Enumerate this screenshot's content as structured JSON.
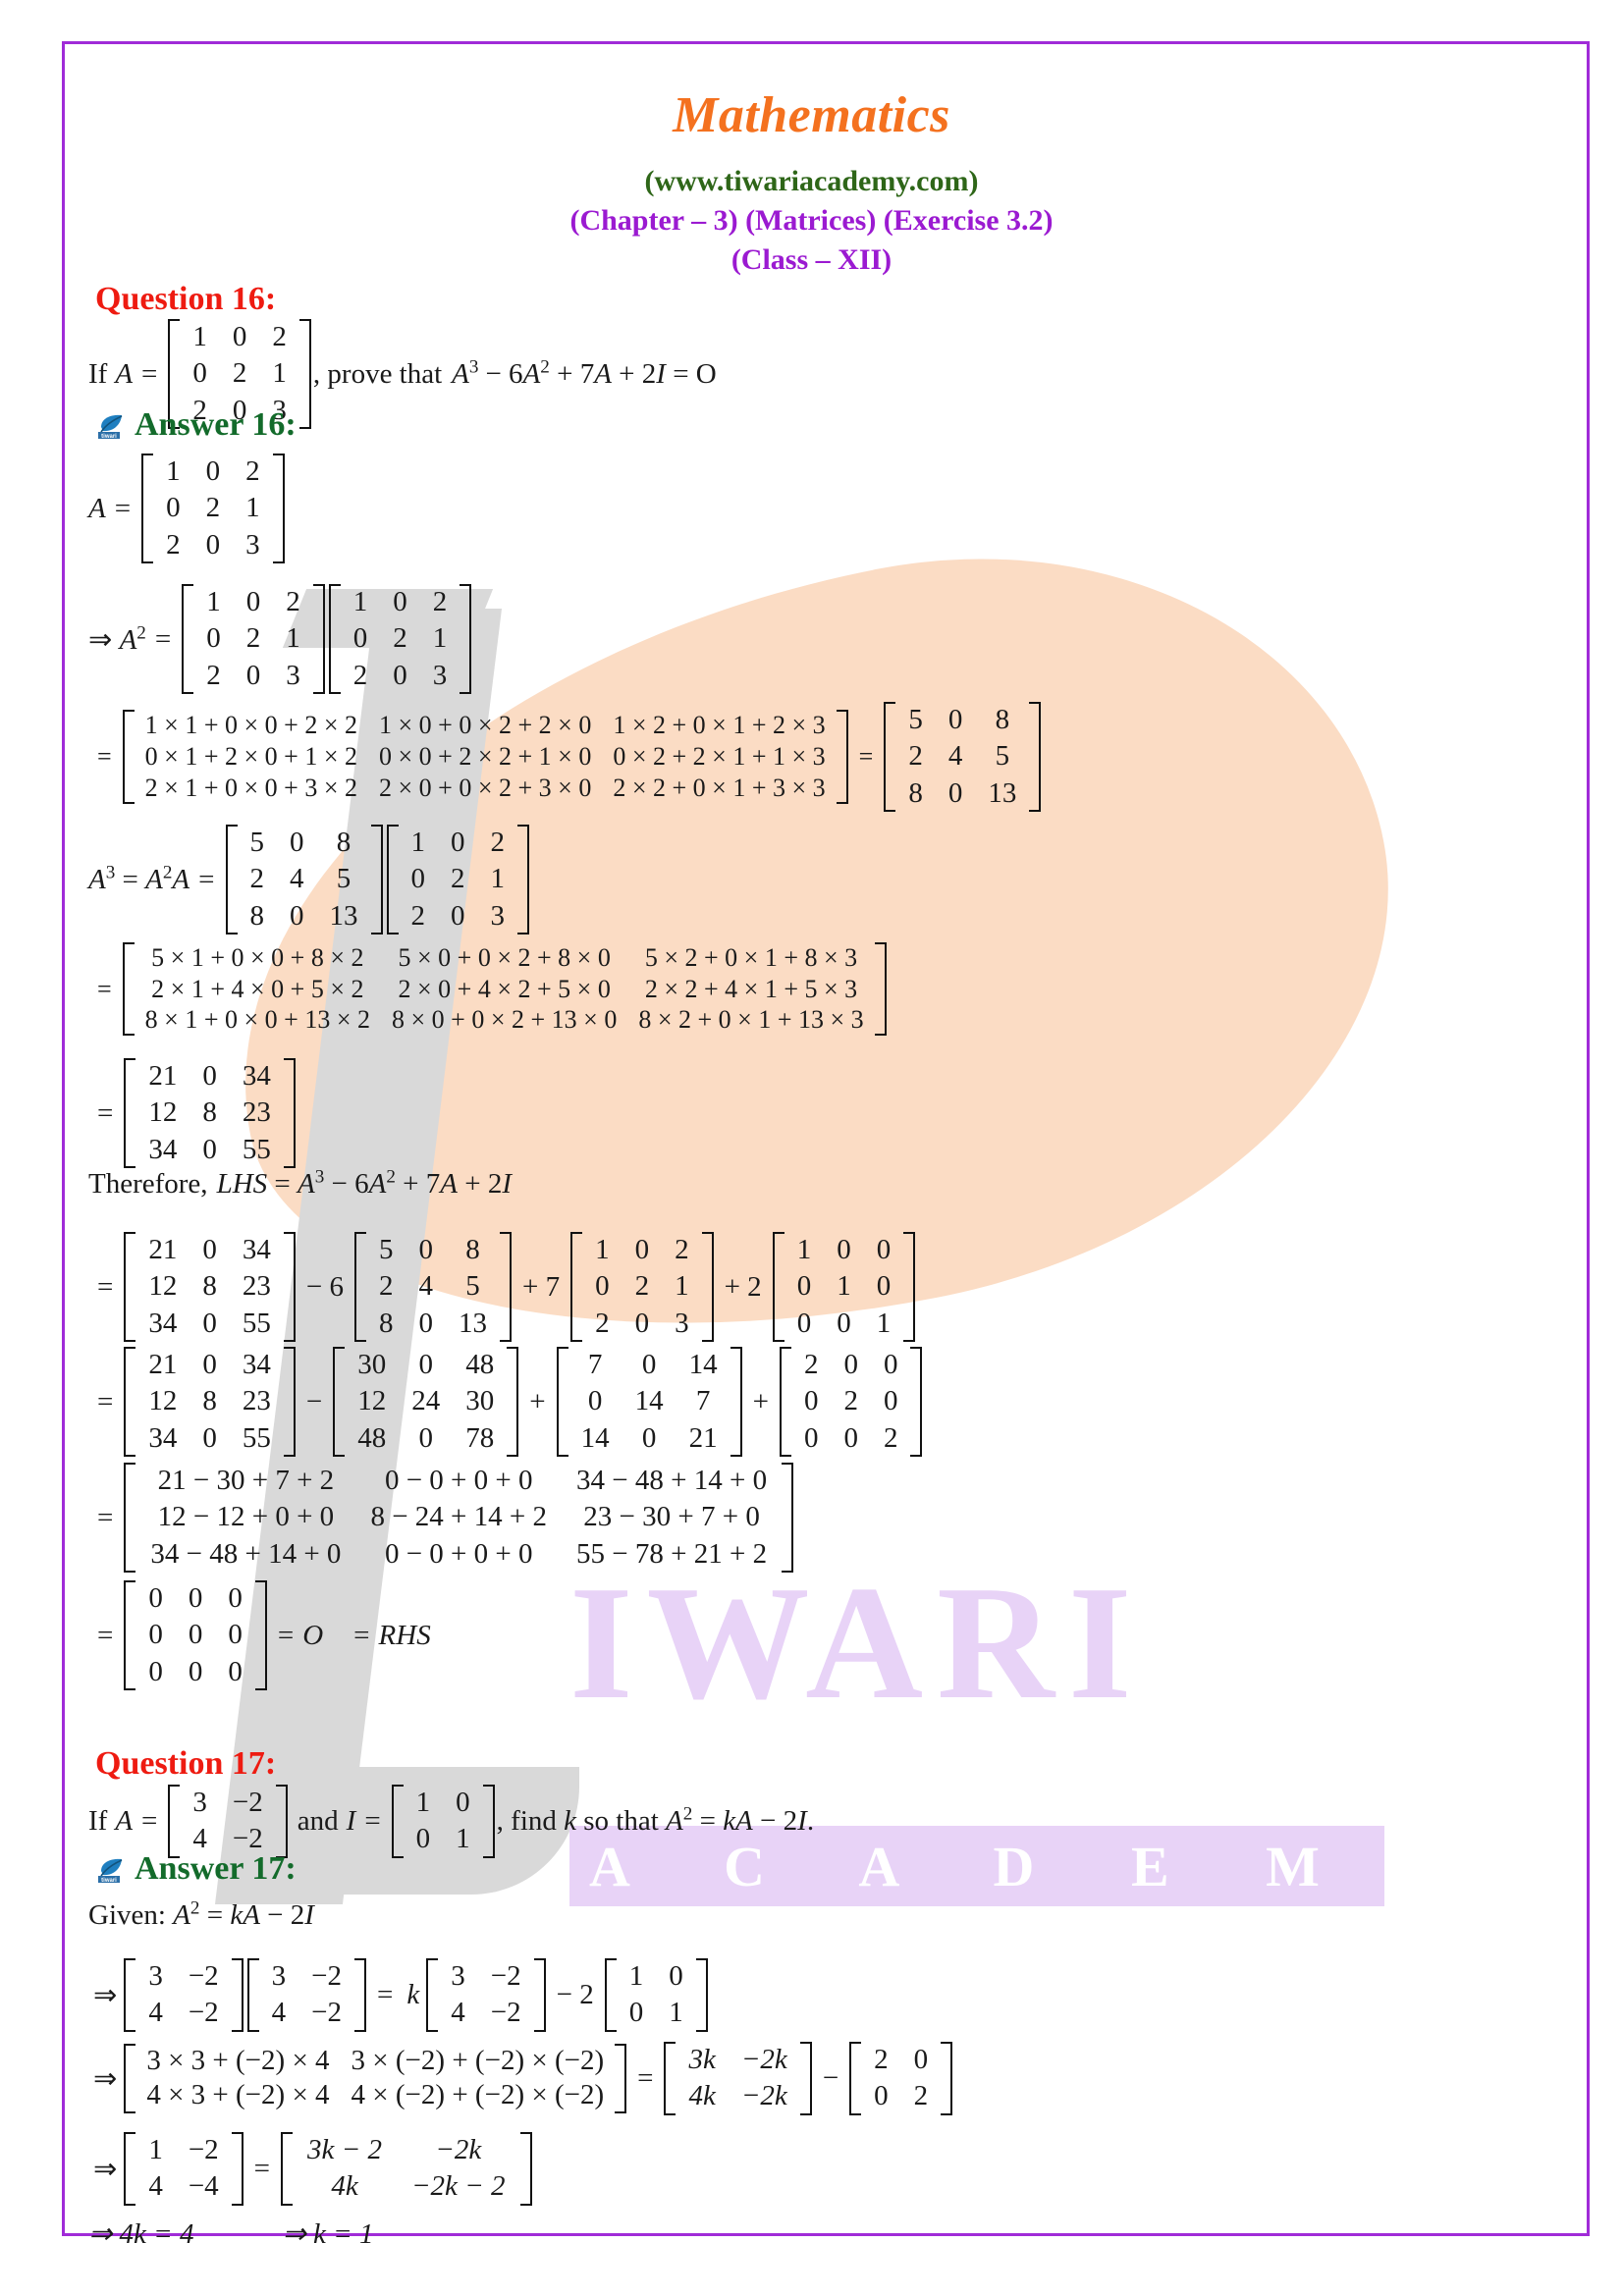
{
  "header": {
    "title": "Mathematics",
    "site": "(www.tiwariacademy.com)",
    "subtitle1": "(Chapter – 3) (Matrices) (Exercise 3.2)",
    "subtitle2": "(Class – XII)"
  },
  "watermark": {
    "big_text": "IWARI",
    "band_text": "A C A D E M Y"
  },
  "colors": {
    "border": "#a02bd8",
    "title": "#f4711f",
    "site": "#2e6618",
    "subtitle": "#9b1ad1",
    "question": "#ee1b11",
    "answer": "#136b2b",
    "watermark_peach": "#fbdcc4",
    "watermark_grey": "#d9d9d9",
    "watermark_purple": "#e8d3f7"
  },
  "q16": {
    "label": "Question 16:",
    "answer_label": "Answer 16:",
    "prompt_lead": "If",
    "prompt_var": "A",
    "prompt_eq": "=",
    "prompt_tail": ", prove that",
    "prompt_expr_a3": "A",
    "prompt_expr": "− 6A + 7A + 2I = O",
    "matrix_A": [
      [
        "1",
        "0",
        "2"
      ],
      [
        "0",
        "2",
        "1"
      ],
      [
        "2",
        "0",
        "3"
      ]
    ],
    "a_eq_lead": "A",
    "a2_lead": "⇒ A",
    "a2_expansion": [
      [
        "1 × 1 + 0 × 0 + 2 × 2",
        "1 × 0 + 0 × 2 + 2 × 0",
        "1 × 2 + 0 × 1 + 2 × 3"
      ],
      [
        "0 × 1 + 2 × 0 + 1 × 2",
        "0 × 0 + 2 × 2 + 1 × 0",
        "0 × 2 + 2 × 1 + 1 × 3"
      ],
      [
        "2 × 1 + 0 × 0 + 3 × 2",
        "2 × 0 + 0 × 2 + 3 × 0",
        "2 × 2 + 0 × 1 + 3 × 3"
      ]
    ],
    "matrix_A2": [
      [
        "5",
        "0",
        "8"
      ],
      [
        "2",
        "4",
        "5"
      ],
      [
        "8",
        "0",
        "13"
      ]
    ],
    "a3_label_1": "A",
    "a3_label_2": "= A",
    "a3_label_3": "A",
    "a3_expansion": [
      [
        "5 × 1 + 0 × 0 + 8 × 2",
        "5 × 0 + 0 × 2 + 8 × 0",
        "5 × 2 + 0 × 1 + 8 × 3"
      ],
      [
        "2 × 1 + 4 × 0 + 5 × 2",
        "2 × 0 + 4 × 2 + 5 × 0",
        "2 × 2 + 4 × 1 + 5 × 3"
      ],
      [
        "8 × 1 + 0 × 0 + 13 × 2",
        "8 × 0 + 0 × 2 + 13 × 0",
        "8 × 2 + 0 × 1 + 13 × 3"
      ]
    ],
    "matrix_A3": [
      [
        "21",
        "0",
        "34"
      ],
      [
        "12",
        "8",
        "23"
      ],
      [
        "34",
        "0",
        "55"
      ]
    ],
    "therefore_text": "Therefore,",
    "therefore_lhs": "LHS = A",
    "therefore_rest": "− 6A + 7A + 2I",
    "scalar_minus6": "− 6",
    "scalar_plus7": "+ 7",
    "scalar_plus2": "+ 2",
    "matrix_I": [
      [
        "1",
        "0",
        "0"
      ],
      [
        "0",
        "1",
        "0"
      ],
      [
        "0",
        "0",
        "1"
      ]
    ],
    "matrix_6A2": [
      [
        "30",
        "0",
        "48"
      ],
      [
        "12",
        "24",
        "30"
      ],
      [
        "48",
        "0",
        "78"
      ]
    ],
    "matrix_7A": [
      [
        "7",
        "0",
        "14"
      ],
      [
        "0",
        "14",
        "7"
      ],
      [
        "14",
        "0",
        "21"
      ]
    ],
    "matrix_2I": [
      [
        "2",
        "0",
        "0"
      ],
      [
        "0",
        "2",
        "0"
      ],
      [
        "0",
        "0",
        "2"
      ]
    ],
    "sum_expansion": [
      [
        "21 − 30 + 7 + 2",
        "0 − 0 + 0 + 0",
        "34 − 48 + 14 + 0"
      ],
      [
        "12 − 12 + 0 + 0",
        "8 − 24 + 14 + 2",
        "23 − 30 + 7 + 0"
      ],
      [
        "34 − 48 + 14 + 0",
        "0 − 0 + 0 + 0",
        "55 − 78 + 21 + 2"
      ]
    ],
    "matrix_zero": [
      [
        "0",
        "0",
        "0"
      ],
      [
        "0",
        "0",
        "0"
      ],
      [
        "0",
        "0",
        "0"
      ]
    ],
    "zero_tail_1": "= O",
    "zero_tail_2": "= RHS"
  },
  "q17": {
    "label": "Question 17:",
    "answer_label": "Answer 17:",
    "prompt_lead": "If",
    "prompt_var": "A",
    "prompt_and": "and",
    "prompt_I": "I",
    "prompt_tail": ", find k so that A",
    "prompt_tail2": "= kA − 2I.",
    "matrix_A": [
      [
        "3",
        "−2"
      ],
      [
        "4",
        "−2"
      ]
    ],
    "matrix_I": [
      [
        "1",
        "0"
      ],
      [
        "0",
        "1"
      ]
    ],
    "given_label": "Given: A",
    "given_rest": "= kA − 2I",
    "step1_arrow": "⇒",
    "step1_eq": "=",
    "step1_k": "k",
    "step1_minus2": "− 2",
    "step2_arrow": "⇒",
    "step2_expansion": [
      [
        "3 × 3 + (−2) × 4",
        "3 × (−2) + (−2) × (−2)"
      ],
      [
        "4 × 3 + (−2) × 4",
        "4 × (−2) + (−2) × (−2)"
      ]
    ],
    "step2_eq": "=",
    "matrix_kA": [
      [
        "3k",
        "−2k"
      ],
      [
        "4k",
        "−2k"
      ]
    ],
    "step2_minus": "−",
    "matrix_2I": [
      [
        "2",
        "0"
      ],
      [
        "0",
        "2"
      ]
    ],
    "step3_arrow": "⇒",
    "matrix_A2_result": [
      [
        "1",
        "−2"
      ],
      [
        "4",
        "−4"
      ]
    ],
    "step3_eq": "=",
    "matrix_rhs": [
      [
        "3k − 2",
        "−2k"
      ],
      [
        "4k",
        "−2k − 2"
      ]
    ],
    "final_1": "⇒ 4k = 4",
    "final_2": "⇒ k = 1"
  }
}
